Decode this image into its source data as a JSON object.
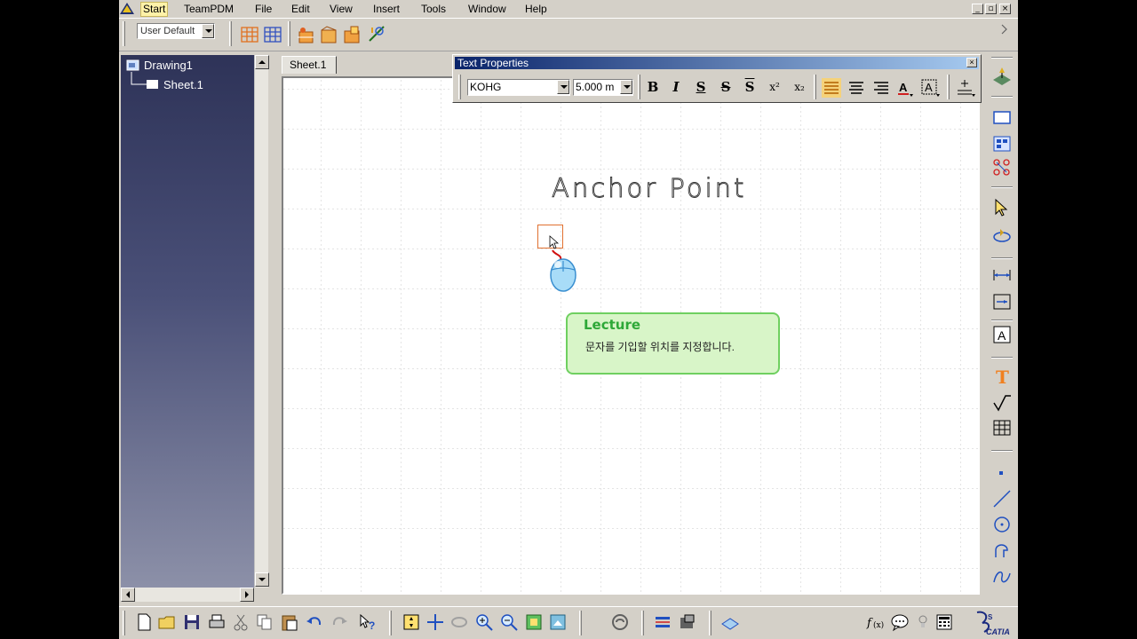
{
  "menu": {
    "items": [
      "Start",
      "TeamPDM",
      "File",
      "Edit",
      "View",
      "Insert",
      "Tools",
      "Window",
      "Help"
    ],
    "active": "Start"
  },
  "window_controls": [
    "_",
    "▫",
    "×"
  ],
  "toolbar": {
    "workbench_select": "User Default"
  },
  "tree": {
    "root": "Drawing1",
    "child": "Sheet.1"
  },
  "sheet_tab": "Sheet.1",
  "text_properties": {
    "title": "Text Properties",
    "font": "KOHG",
    "size": "5.000 m",
    "buttons": {
      "bold": "B",
      "italic": "I",
      "underline": "S",
      "strike": "S",
      "overline": "S",
      "superscript": "x²",
      "subscript": "x₂"
    }
  },
  "canvas": {
    "heading": "Anchor Point"
  },
  "lecture": {
    "title": "Lecture",
    "text": "문자를 기입할 위치를 지정합니다."
  },
  "brand": "CATIA",
  "colors": {
    "menu_highlight": "#fff2a8",
    "lecture_bg": "#d8f5c8",
    "lecture_border": "#6fd060",
    "lecture_title": "#2ea838",
    "titlebar": "#0a246a",
    "tree_bg": "#3a3f66"
  }
}
